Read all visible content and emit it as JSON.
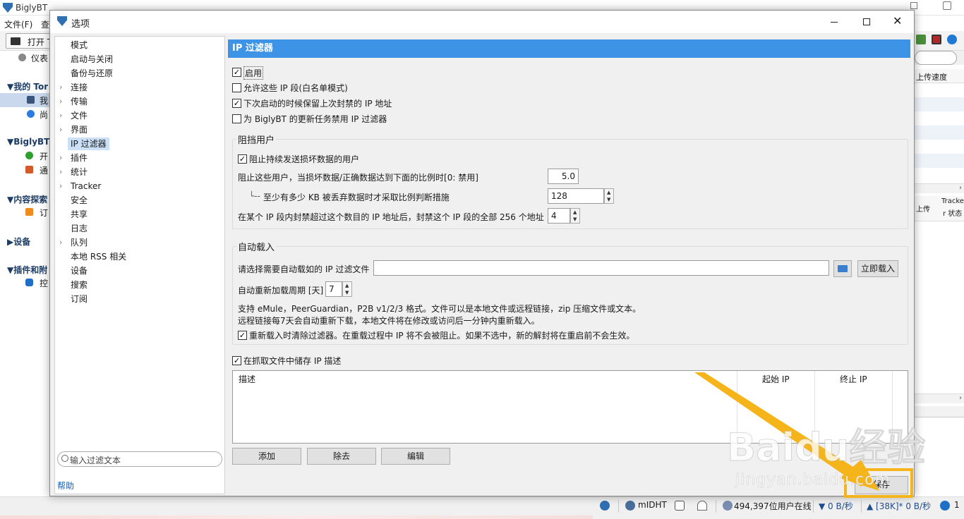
{
  "main_window": {
    "title": "BiglyBT",
    "menu": [
      "文件(F)",
      "查"
    ],
    "toolbar_open_label": "打开 T",
    "sidebar": {
      "dashboard": "仪表",
      "my_torrents_header": "▼我的 Tor",
      "my_torrents_item": "我",
      "unfinished_item": "尚",
      "biglybt_header": "▼BiglyBT",
      "biglybt_start": "开",
      "biglybt_notify": "通",
      "content_header": "▼内容探索",
      "content_subscribe": "订",
      "devices_header": "▶设备",
      "plugins_header": "▼插件和附",
      "plugins_control": "控"
    },
    "right_panel": {
      "upload_speed_header": "上传速度",
      "tracker_col": "Tracke",
      "tracker_status": "r 状态",
      "upload_col": "上传"
    },
    "status_bar": {
      "dht": "mIDHT",
      "users_online": "494,397位用户在线",
      "down_speed": "▼ 0 B/秒",
      "up_speed": "▲ [38K]* 0 B/秒",
      "info_count": "1"
    }
  },
  "dialog": {
    "title": "选项",
    "tree_items": [
      {
        "label": "模式",
        "expandable": false
      },
      {
        "label": "启动与关闭",
        "expandable": false
      },
      {
        "label": "备份与还原",
        "expandable": false
      },
      {
        "label": "连接",
        "expandable": true
      },
      {
        "label": "传输",
        "expandable": true
      },
      {
        "label": "文件",
        "expandable": true
      },
      {
        "label": "界面",
        "expandable": true
      },
      {
        "label": "IP 过滤器",
        "expandable": false,
        "selected": true
      },
      {
        "label": "插件",
        "expandable": true
      },
      {
        "label": "统计",
        "expandable": true
      },
      {
        "label": "Tracker",
        "expandable": true
      },
      {
        "label": "安全",
        "expandable": false
      },
      {
        "label": "共享",
        "expandable": false
      },
      {
        "label": "日志",
        "expandable": false
      },
      {
        "label": "队列",
        "expandable": true
      },
      {
        "label": "本地 RSS 相关",
        "expandable": false
      },
      {
        "label": "设备",
        "expandable": false
      },
      {
        "label": "搜索",
        "expandable": false
      },
      {
        "label": "订阅",
        "expandable": false
      }
    ],
    "filter_placeholder": "输入过滤文本",
    "help_link": "帮助",
    "panel_title": "IP 过滤器",
    "options": {
      "enable": {
        "label": "启用",
        "checked": true
      },
      "whitelist": {
        "label": "允许这些 IP 段(白名单模式)",
        "checked": false
      },
      "persist_banned": {
        "label": "下次启动的时候保留上次封禁的 IP 地址",
        "checked": true
      },
      "disable_for_updates": {
        "label": "为 BiglyBT 的更新任务禁用 IP 过滤器",
        "checked": false
      }
    },
    "block_group": {
      "title": "阻挡用户",
      "block_bad_data": {
        "label": "阻止持续发送损坏数据的用户",
        "checked": true
      },
      "ratio_label": "阻止这些用户，当损坏数据/正确数据达到下面的比例时[0: 禁用]",
      "ratio_value": "5.0",
      "min_kb_label": "至少有多少 KB 被丢弃数据时才采取比例判断措施",
      "min_kb_value": "128",
      "range_label": "在某个 IP 段内封禁超过这个数目的 IP 地址后，封禁这个 IP 段的全部 256 个地址",
      "range_value": "4"
    },
    "autoload_group": {
      "title": "自动载入",
      "file_label": "请选择需要自动载如的 IP 过滤文件",
      "file_value": "",
      "load_now_button": "立即载入",
      "period_label": "自动重新加载周期 [天]",
      "period_value": "7",
      "info_line1": "支持 eMule，PeerGuardian，P2B v1/2/3 格式。文件可以是本地文件或远程链接，zip 压缩文件或文本。",
      "info_line2": "远程链接每7天会自动重新下载，本地文件将在修改或访问后一分钟内重新载入。",
      "clear_on_reload": {
        "label": "重新载入时清除过滤器。在重载过程中 IP 将不会被阻止。如果不选中，新的解封将在重启前不会生效。",
        "checked": true
      }
    },
    "store_desc": {
      "label": "在抓取文件中储存 IP 描述",
      "checked": true
    },
    "table": {
      "columns": [
        "描述",
        "起始 IP",
        "终止 IP"
      ],
      "rows": []
    },
    "buttons": {
      "add": "添加",
      "remove": "除去",
      "edit": "编辑",
      "save": "保存"
    }
  },
  "watermark": {
    "brand": "Baidu经验",
    "url": "jingyan.baidu.com"
  },
  "colors": {
    "accent": "#3d94e6",
    "highlight": "#f5b51a",
    "selected_tree": "#cce0f7"
  }
}
